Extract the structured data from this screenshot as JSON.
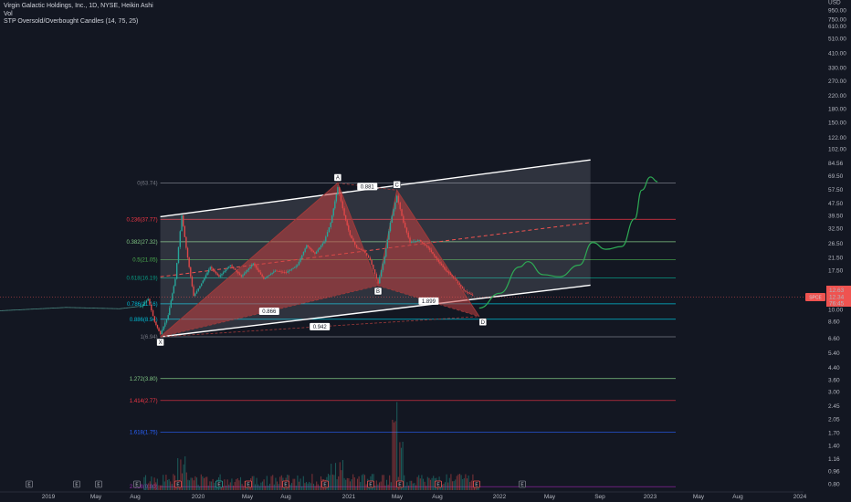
{
  "legend": {
    "title": "Virgin Galactic Holdings, Inc., 1D, NYSE, Heikin Ashi",
    "line2": "Vol",
    "line3": "STP Oversold/Overbought Candles (14, 75, 25)"
  },
  "colors": {
    "background": "#131722",
    "candle_red": "#e04848",
    "candle_green": "#26a69a",
    "pattern_fill": "#c44040",
    "channel": "#ffffff",
    "projection": "#2eac55"
  },
  "chart_data": {
    "type": "candlestick",
    "symbol": "SPCE",
    "price_scale": "log",
    "y_ticks": [
      "USD",
      "950.00",
      "750.00",
      "610.00",
      "510.00",
      "410.00",
      "330.00",
      "270.00",
      "220.00",
      "180.00",
      "150.00",
      "122.00",
      "102.00",
      "84.56",
      "69.50",
      "57.50",
      "47.50",
      "39.50",
      "32.50",
      "26.50",
      "21.50",
      "17.50",
      "12.34",
      "10.00",
      "8.60",
      "6.60",
      "5.40",
      "4.40",
      "3.60",
      "3.00",
      "2.45",
      "2.05",
      "1.70",
      "1.40",
      "1.16",
      "0.96",
      "0.80"
    ],
    "x_ticks": [
      "2019",
      "May",
      "Aug",
      "2020",
      "May",
      "Aug",
      "2021",
      "May",
      "Aug",
      "2022",
      "May",
      "Sep",
      "2023",
      "May",
      "Aug",
      "2024"
    ],
    "price_badges": [
      {
        "label": "SPCE",
        "value": "12.34"
      },
      {
        "value": "12.63"
      },
      {
        "value": "76:45"
      }
    ],
    "fib_levels": [
      {
        "label": "0(63.74)",
        "value": 63.74,
        "color": "#787b86"
      },
      {
        "label": "0.236(37.77)",
        "value": 37.77,
        "color": "#f23645"
      },
      {
        "label": "0.382(27.32)",
        "value": 27.32,
        "color": "#81c784"
      },
      {
        "label": "0.5(21.05)",
        "value": 21.05,
        "color": "#4caf50"
      },
      {
        "label": "0.618(16.19)",
        "value": 16.19,
        "color": "#089981"
      },
      {
        "label": "0.786(11.16)",
        "value": 11.16,
        "color": "#00bcd4"
      },
      {
        "label": "0.886(8.94)",
        "value": 8.94,
        "color": "#00bcd4"
      },
      {
        "label": "1(6.94)",
        "value": 6.94,
        "color": "#787b86"
      },
      {
        "label": "1.272(3.80)",
        "value": 3.8,
        "color": "#81c784"
      },
      {
        "label": "1.414(2.77)",
        "value": 2.77,
        "color": "#f23645"
      },
      {
        "label": "1.618(1.75)",
        "value": 1.75,
        "color": "#2962ff"
      },
      {
        "label": "2.618(0.80)",
        "value": 0.8,
        "color": "#9c27b0"
      }
    ],
    "pattern_points": [
      {
        "label": "X",
        "date": "2020-01-02",
        "price": 6.94
      },
      {
        "label": "A",
        "date": "2021-02-10",
        "price": 63.74
      },
      {
        "label": "B",
        "date": "2021-05-13",
        "price": 14.5
      },
      {
        "label": "C",
        "date": "2021-06-25",
        "price": 57.5
      },
      {
        "label": "D",
        "date": "2021-12-30",
        "price": 9.3
      }
    ],
    "pattern_ratios": [
      "0.866",
      "0.881",
      "1.899",
      "0.942"
    ],
    "price_series": [
      {
        "date": "2019-01-01",
        "close": 10.1
      },
      {
        "date": "2019-06-01",
        "close": 10.6
      },
      {
        "date": "2019-10-01",
        "close": 10.4
      },
      {
        "date": "2019-11-20",
        "close": 10.8
      },
      {
        "date": "2019-12-05",
        "close": 12.0
      },
      {
        "date": "2019-12-20",
        "close": 8.6
      },
      {
        "date": "2020-01-02",
        "close": 7.2
      },
      {
        "date": "2020-01-20",
        "close": 9.5
      },
      {
        "date": "2020-02-05",
        "close": 16
      },
      {
        "date": "2020-02-20",
        "close": 40
      },
      {
        "date": "2020-03-01",
        "close": 25
      },
      {
        "date": "2020-03-18",
        "close": 12.5
      },
      {
        "date": "2020-04-05",
        "close": 15
      },
      {
        "date": "2020-04-25",
        "close": 19
      },
      {
        "date": "2020-05-15",
        "close": 16.5
      },
      {
        "date": "2020-06-10",
        "close": 19.5
      },
      {
        "date": "2020-07-05",
        "close": 16.5
      },
      {
        "date": "2020-08-01",
        "close": 20
      },
      {
        "date": "2020-08-25",
        "close": 16
      },
      {
        "date": "2020-09-20",
        "close": 18
      },
      {
        "date": "2020-10-15",
        "close": 17.5
      },
      {
        "date": "2020-11-10",
        "close": 19.5
      },
      {
        "date": "2020-12-01",
        "close": 26
      },
      {
        "date": "2020-12-20",
        "close": 23
      },
      {
        "date": "2021-01-10",
        "close": 27.5
      },
      {
        "date": "2021-01-25",
        "close": 36
      },
      {
        "date": "2021-02-10",
        "close": 60
      },
      {
        "date": "2021-02-25",
        "close": 40
      },
      {
        "date": "2021-03-10",
        "close": 30
      },
      {
        "date": "2021-03-25",
        "close": 25
      },
      {
        "date": "2021-04-10",
        "close": 24
      },
      {
        "date": "2021-04-25",
        "close": 21
      },
      {
        "date": "2021-05-13",
        "close": 15
      },
      {
        "date": "2021-05-28",
        "close": 22
      },
      {
        "date": "2021-06-10",
        "close": 36
      },
      {
        "date": "2021-06-25",
        "close": 53
      },
      {
        "date": "2021-07-10",
        "close": 36
      },
      {
        "date": "2021-07-25",
        "close": 27
      },
      {
        "date": "2021-08-15",
        "close": 28
      },
      {
        "date": "2021-09-05",
        "close": 25
      },
      {
        "date": "2021-09-25",
        "close": 21
      },
      {
        "date": "2021-10-15",
        "close": 18
      },
      {
        "date": "2021-11-05",
        "close": 16
      },
      {
        "date": "2021-11-25",
        "close": 13.5
      },
      {
        "date": "2021-12-15",
        "close": 12.6
      }
    ],
    "projection": [
      {
        "date": "2021-12-30",
        "price": 10.5
      },
      {
        "date": "2022-02-15",
        "price": 13
      },
      {
        "date": "2022-04-01",
        "price": 19
      },
      {
        "date": "2022-04-20",
        "price": 20.5
      },
      {
        "date": "2022-05-25",
        "price": 17
      },
      {
        "date": "2022-07-01",
        "price": 16.5
      },
      {
        "date": "2022-08-15",
        "price": 19.5
      },
      {
        "date": "2022-09-15",
        "price": 27
      },
      {
        "date": "2022-10-15",
        "price": 24.5
      },
      {
        "date": "2022-11-20",
        "price": 25.5
      },
      {
        "date": "2022-12-20",
        "price": 38
      },
      {
        "date": "2023-01-05",
        "price": 57.5
      },
      {
        "date": "2023-01-25",
        "price": 69.5
      },
      {
        "date": "2023-02-10",
        "price": 65
      }
    ],
    "channel": {
      "upper": [
        {
          "date": "2020-01-02",
          "price": 39.2
        },
        {
          "date": "2022-09-10",
          "price": 89
        }
      ],
      "lower": [
        {
          "date": "2020-01-02",
          "price": 6.94
        },
        {
          "date": "2022-09-10",
          "price": 14.6
        }
      ]
    },
    "volume_markers": [
      "E",
      "E",
      "E",
      "E",
      "E",
      "E",
      "E",
      "E",
      "E",
      "E",
      "E",
      "E",
      "E",
      "E",
      "E",
      "E",
      "E",
      "E"
    ]
  }
}
